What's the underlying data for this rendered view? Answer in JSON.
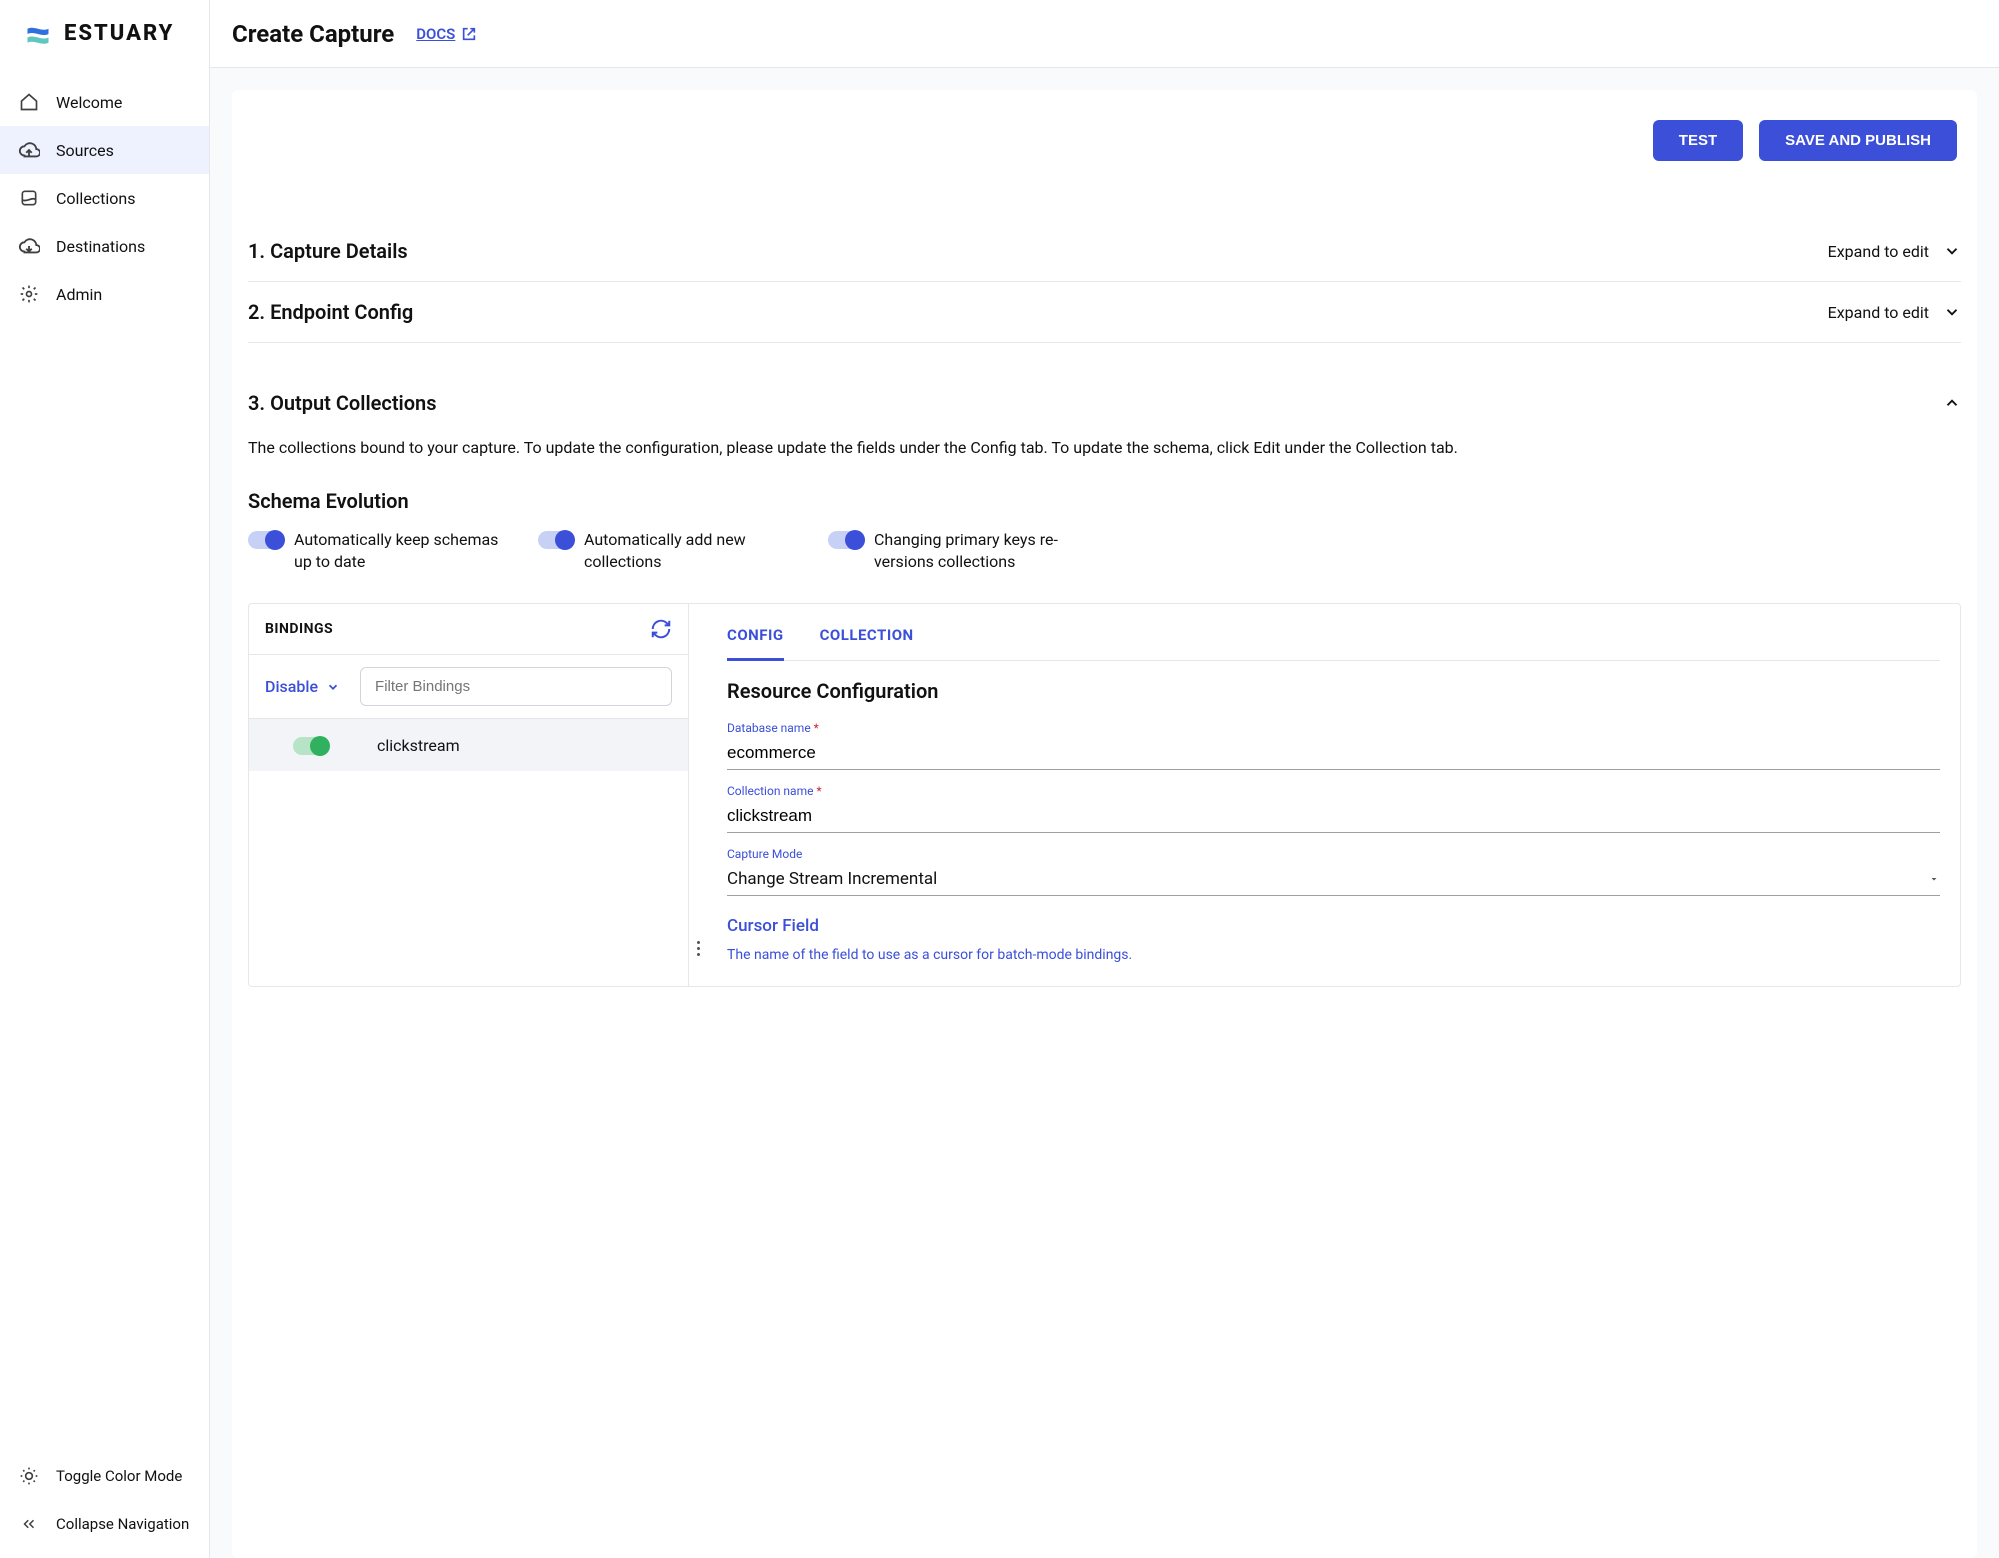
{
  "brand": "ESTUARY",
  "header": {
    "title": "Create Capture",
    "docs_label": "DOCS"
  },
  "sidebar": {
    "items": [
      {
        "label": "Welcome",
        "icon": "home-icon"
      },
      {
        "label": "Sources",
        "icon": "cloud-up-icon"
      },
      {
        "label": "Collections",
        "icon": "collections-icon"
      },
      {
        "label": "Destinations",
        "icon": "cloud-down-icon"
      },
      {
        "label": "Admin",
        "icon": "gear-icon"
      }
    ],
    "toggle_color": "Toggle Color Mode",
    "collapse_nav": "Collapse Navigation"
  },
  "actions": {
    "test": "TEST",
    "save_publish": "SAVE AND PUBLISH"
  },
  "sections": {
    "capture_details": {
      "title": "1. Capture Details",
      "expand": "Expand to edit"
    },
    "endpoint_config": {
      "title": "2. Endpoint Config",
      "expand": "Expand to edit"
    },
    "output_collections": {
      "title": "3. Output Collections",
      "description": "The collections bound to your capture. To update the configuration, please update the fields under the Config tab. To update the schema, click Edit under the Collection tab.",
      "schema_evolution_heading": "Schema Evolution",
      "toggles": [
        "Automatically keep schemas up to date",
        "Automatically add new collections",
        "Changing primary keys re-versions collections"
      ]
    }
  },
  "bindings": {
    "heading": "BINDINGS",
    "disable_label": "Disable",
    "filter_placeholder": "Filter Bindings",
    "rows": [
      {
        "name": "clickstream"
      }
    ]
  },
  "config_panel": {
    "tabs": {
      "config": "CONFIG",
      "collection": "COLLECTION"
    },
    "heading": "Resource Configuration",
    "fields": {
      "db_label": "Database name",
      "db_value": "ecommerce",
      "coll_label": "Collection name",
      "coll_value": "clickstream",
      "mode_label": "Capture Mode",
      "mode_value": "Change Stream Incremental",
      "cursor_heading": "Cursor Field",
      "cursor_desc": "The name of the field to use as a cursor for batch-mode bindings."
    }
  }
}
